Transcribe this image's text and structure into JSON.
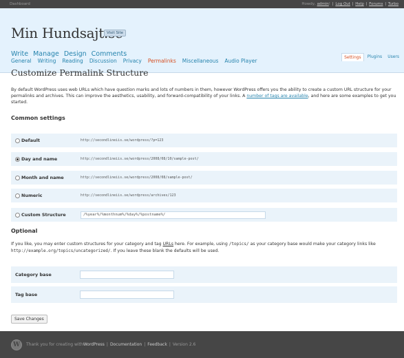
{
  "topbar": {
    "left": "Dashboard",
    "howdy": "Howdy, ",
    "user": "admin",
    "exclam": "!",
    "links": [
      "Log Out",
      "Help",
      "Forums",
      "Turbo"
    ]
  },
  "site": {
    "title": "Min Hundsajt.se",
    "visit_label": "Visit Site"
  },
  "main_nav": [
    "Write",
    "Manage",
    "Design",
    "Comments"
  ],
  "right_nav": [
    "Settings",
    "Plugins",
    "Users"
  ],
  "sub_nav": [
    "General",
    "Writing",
    "Reading",
    "Discussion",
    "Privacy",
    "Permalinks",
    "Miscellaneous",
    "Audio Player"
  ],
  "page_title": "Customize Permalink Structure",
  "intro": {
    "text": "By default WordPress uses web URLs which have question marks and lots of numbers in them, however WordPress offers you the ability to create a custom URL structure for your permalinks and archives. This can improve the aesthetics, usability, and forward-compatibility of your links. A ",
    "link": "number of tags are available",
    "tail": ", and here are some examples to get you started."
  },
  "common": {
    "heading": "Common settings",
    "options": [
      {
        "label": "Default",
        "example": "http://secondlineiis.se/wordpress/?p=123",
        "checked": false
      },
      {
        "label": "Day and name",
        "example": "http://secondlineiis.se/wordpress/2008/08/10/sample-post/",
        "checked": true
      },
      {
        "label": "Month and name",
        "example": "http://secondlineiis.se/wordpress/2008/08/sample-post/",
        "checked": false
      },
      {
        "label": "Numeric",
        "example": "http://secondlineiis.se/wordpress/archives/123",
        "checked": false
      }
    ],
    "custom_label": "Custom Structure",
    "custom_value": "/%year%/%monthnum%/%day%/%postname%/"
  },
  "optional": {
    "heading": "Optional",
    "p1": "If you like, you may enter custom structures for your category and tag ",
    "urls": "URLs",
    "p2": " here. For example, using ",
    "code1": "/topics/",
    "p3": " as your category base would make your category links like ",
    "code2": "http://example.org/topics/uncategorized/",
    "p4": ". If you leave these blank the defaults will be used.",
    "category_label": "Category base",
    "category_value": "",
    "tag_label": "Tag base",
    "tag_value": ""
  },
  "save_label": "Save Changes",
  "footer": {
    "logo": "W",
    "thanks": "Thank you for creating with ",
    "wordpress": "WordPress",
    "documentation": "Documentation",
    "feedback": "Feedback",
    "version": "Version 2.6",
    "sep": "|"
  }
}
